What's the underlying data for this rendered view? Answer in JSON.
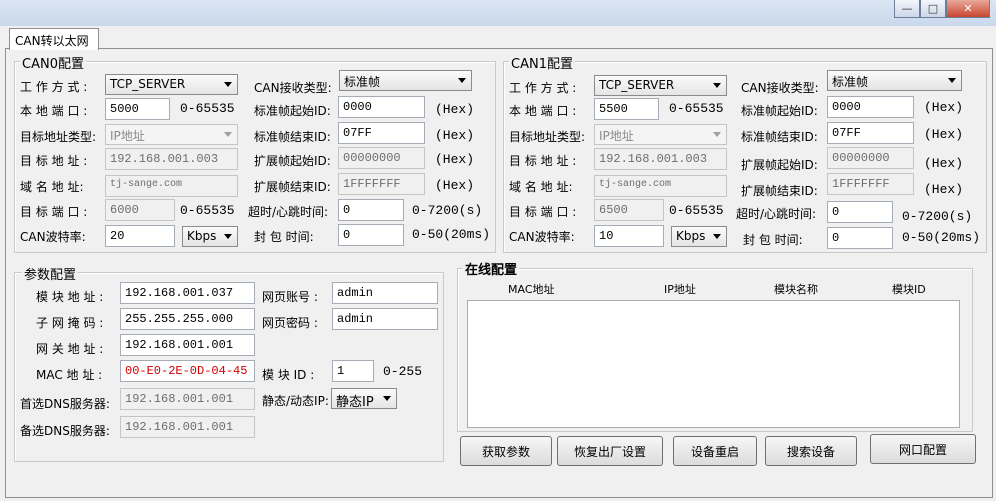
{
  "window": {
    "minimize": "—",
    "maximize": "□",
    "close": "✕"
  },
  "tab": {
    "label": "CAN转以太网"
  },
  "can0": {
    "title": "CAN0配置",
    "mode_label": "工 作 方 式 :",
    "mode_value": "TCP_SERVER",
    "local_port_label": "本 地 端 口 :",
    "local_port_value": "5000",
    "local_port_range": "0-65535",
    "target_type_label": "目标地址类型:",
    "target_type_value": "IP地址",
    "target_addr_label": "目 标 地 址 :",
    "target_addr_value": "192.168.001.003",
    "domain_label": "域 名 地 址:",
    "domain_value": "tj-sange.com",
    "target_port_label": "目 标 端 口 :",
    "target_port_value": "6000",
    "target_port_range": "0-65535",
    "baud_label": "CAN波特率:",
    "baud_value": "20",
    "baud_unit": "Kbps",
    "recv_type_label": "CAN接收类型:",
    "recv_type_value": "标准帧",
    "std_start_label": "标准帧起始ID:",
    "std_start_value": "0000",
    "std_start_hint": "(Hex)",
    "std_end_label": "标准帧结束ID:",
    "std_end_value": "07FF",
    "std_end_hint": "(Hex)",
    "ext_start_label": "扩展帧起始ID:",
    "ext_start_value": "00000000",
    "ext_start_hint": "(Hex)",
    "ext_end_label": "扩展帧结束ID:",
    "ext_end_value": "1FFFFFFF",
    "ext_end_hint": "(Hex)",
    "timeout_label": "超时/心跳时间:",
    "timeout_value": "0",
    "timeout_range": "0-7200(s)",
    "pack_label": "封 包 时间:",
    "pack_value": "0",
    "pack_range": "0-50(20ms)"
  },
  "can1": {
    "title": "CAN1配置",
    "mode_label": "工 作 方 式 :",
    "mode_value": "TCP_SERVER",
    "local_port_label": "本 地 端 口 :",
    "local_port_value": "5500",
    "local_port_range": "0-65535",
    "target_type_label": "目标地址类型:",
    "target_type_value": "IP地址",
    "target_addr_label": "目 标 地 址 :",
    "target_addr_value": "192.168.001.003",
    "domain_label": "域 名 地 址:",
    "domain_value": "tj-sange.com",
    "target_port_label": "目 标 端 口 :",
    "target_port_value": "6500",
    "target_port_range": "0-65535",
    "baud_label": "CAN波特率:",
    "baud_value": "10",
    "baud_unit": "Kbps",
    "recv_type_label": "CAN接收类型:",
    "recv_type_value": "标准帧",
    "std_start_label": "标准帧起始ID:",
    "std_start_value": "0000",
    "std_start_hint": "(Hex)",
    "std_end_label": "标准帧结束ID:",
    "std_end_value": "07FF",
    "std_end_hint": "(Hex)",
    "ext_start_label": "扩展帧起始ID:",
    "ext_start_value": "00000000",
    "ext_start_hint": "(Hex)",
    "ext_end_label": "扩展帧结束ID:",
    "ext_end_value": "1FFFFFFF",
    "ext_end_hint": "(Hex)",
    "timeout_label": "超时/心跳时间:",
    "timeout_value": "0",
    "timeout_range": "0-7200(s)",
    "pack_label": "封 包 时间:",
    "pack_value": "0",
    "pack_range": "0-50(20ms)"
  },
  "params": {
    "title": "参数配置",
    "ip_label": "模 块 地 址 :",
    "ip_value": "192.168.001.037",
    "mask_label": "子 网 掩 码 :",
    "mask_value": "255.255.255.000",
    "gw_label": "网 关 地 址 :",
    "gw_value": "192.168.001.001",
    "mac_label": "MAC 地 址 :",
    "mac_value": "00-E0-2E-0D-04-45",
    "dns1_label": "首选DNS服务器:",
    "dns1_value": "192.168.001.001",
    "dns2_label": "备选DNS服务器:",
    "dns2_value": "192.168.001.001",
    "web_user_label": "网页账号 :",
    "web_user_value": "admin",
    "web_pwd_label": "网页密码 :",
    "web_pwd_value": "admin",
    "module_id_label": "模 块 ID :",
    "module_id_value": "1",
    "module_id_range": "0-255",
    "ipmode_label": "静态/动态IP:",
    "ipmode_value": "静态IP"
  },
  "online": {
    "title": "在线配置",
    "columns": [
      "MAC地址",
      "IP地址",
      "模块名称",
      "模块ID"
    ]
  },
  "buttons": {
    "get_params": "获取参数",
    "factory_reset": "恢复出厂设置",
    "reboot": "设备重启",
    "search": "搜索设备",
    "net_config": "网口配置"
  },
  "colors": {
    "mac_text": "#d40000"
  }
}
